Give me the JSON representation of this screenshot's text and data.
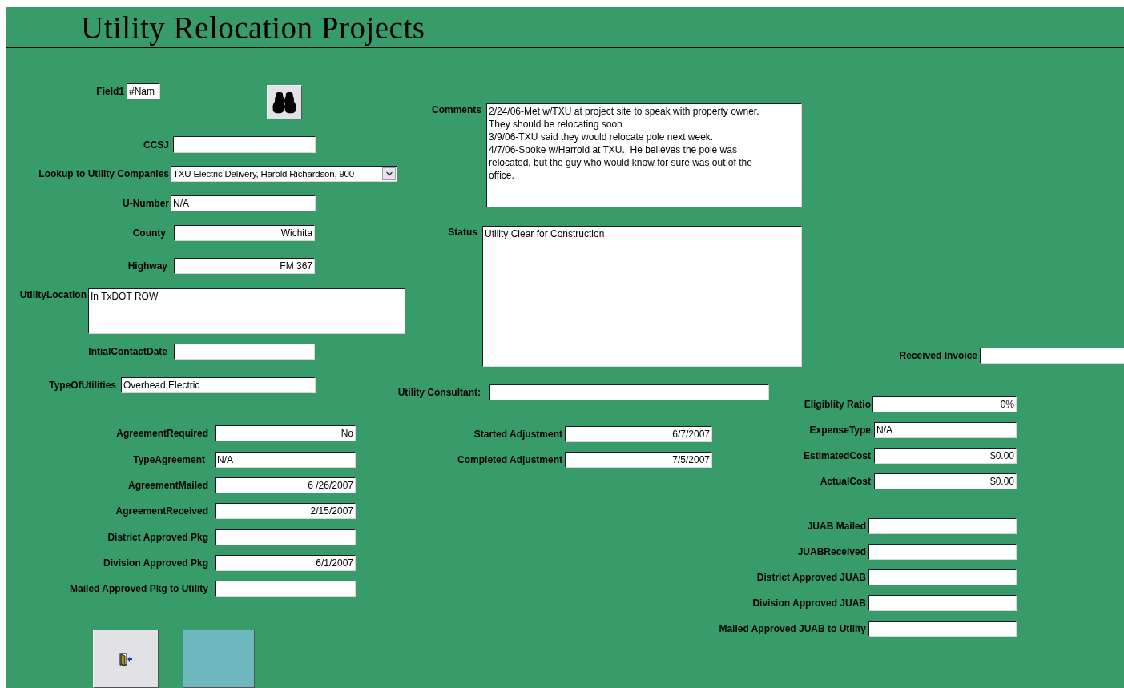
{
  "title": "Utility Relocation Projects",
  "left_fields": [
    {
      "label": "Field1",
      "value": "#Nam",
      "kind": "text"
    },
    {
      "label": "CCSJ",
      "kind": "text"
    },
    {
      "label": "Lookup to Utility Companies",
      "value": "TXU Electric Delivery, Harold Richardson, 900",
      "kind": "combo"
    },
    {
      "label": "U-Number",
      "value": "N/A",
      "kind": "text"
    },
    {
      "label": "County",
      "value": "Wichita",
      "kind": "text"
    },
    {
      "label": "Highway",
      "value": "FM 367",
      "kind": "text"
    },
    {
      "label": "UtilityLocation",
      "value": "In TxDOT ROW",
      "kind": "memo"
    },
    {
      "label": "IntialContactDate",
      "kind": "text"
    },
    {
      "label": "TypeOfUtilities",
      "value": "Overhead Electric",
      "kind": "text"
    },
    {
      "label": "AgreementRequired",
      "value": "No",
      "kind": "text"
    },
    {
      "label": "TypeAgreement",
      "value": "N/A",
      "kind": "text"
    },
    {
      "label": "AgreementMailed",
      "value": "6 /26/2007",
      "kind": "text"
    },
    {
      "label": "AgreementReceived",
      "value": "2/15/2007",
      "kind": "text"
    },
    {
      "label": "District Approved Pkg",
      "kind": "text"
    },
    {
      "label": "Division Approved Pkg",
      "value": "6/1/2007",
      "kind": "text"
    },
    {
      "label": "Mailed Approved Pkg to Utility",
      "kind": "text"
    }
  ],
  "middle_fields": [
    {
      "label": "Comments",
      "value": "2/24/06-Met w/TXU at project site to speak with property owner.\nThey should be relocating soon\n3/9/06-TXU said they would relocate pole next week.\n4/7/06-Spoke w/Harrold at TXU.  He believes the pole was\nrelocated, but the guy who would know for sure was out of the\noffice.",
      "kind": "memo"
    },
    {
      "label": "Status",
      "value": "Utility Clear for Construction",
      "kind": "memo"
    },
    {
      "label": "Utility Consultant:",
      "kind": "text"
    },
    {
      "label": "Started Adjustment",
      "value": "6/7/2007",
      "kind": "text"
    },
    {
      "label": "Completed Adjustment",
      "value": "7/5/2007",
      "kind": "text"
    }
  ],
  "right_fields": [
    {
      "label": "Received Invoice",
      "kind": "text"
    },
    {
      "label": "Eligiblity Ratio",
      "value": "0%",
      "kind": "text"
    },
    {
      "label": "ExpenseType",
      "value": "N/A",
      "kind": "text"
    },
    {
      "label": "EstimatedCost",
      "value": "$0.00",
      "kind": "text"
    },
    {
      "label": "ActualCost",
      "value": "$0.00",
      "kind": "text"
    },
    {
      "label": "JUAB Mailed",
      "kind": "text"
    },
    {
      "label": "JUABReceived",
      "kind": "text"
    },
    {
      "label": "District Approved JUAB",
      "kind": "text"
    },
    {
      "label": "Division Approved JUAB",
      "kind": "text"
    },
    {
      "label": "Mailed Approved JUAB to Utility",
      "kind": "text"
    }
  ]
}
